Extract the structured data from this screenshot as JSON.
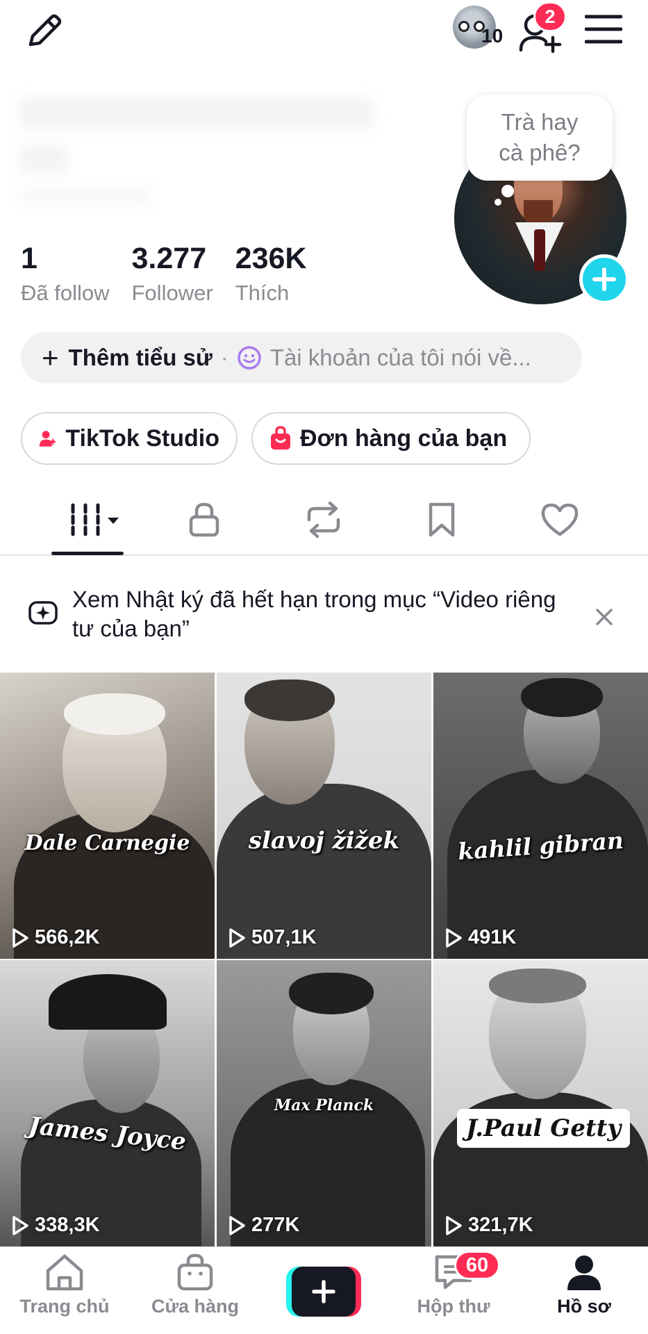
{
  "top_bar": {
    "story_count": "10",
    "friend_requests_badge": "2"
  },
  "profile": {
    "bubble_line1": "Trà hay",
    "bubble_line2": "cà phê?"
  },
  "stats": [
    {
      "value": "1",
      "label": "Đã follow"
    },
    {
      "value": "3.277",
      "label": "Follower"
    },
    {
      "value": "236K",
      "label": "Thích"
    }
  ],
  "bio": {
    "add_label": "Thêm tiểu sử",
    "separator": "·",
    "placeholder": "Tài khoản của tôi nói về..."
  },
  "actions": {
    "studio_label": "TikTok Studio",
    "orders_label": "Đơn hàng của bạn"
  },
  "tabs": [
    {
      "icon": "grid-icon"
    },
    {
      "icon": "lock-icon"
    },
    {
      "icon": "repost-icon"
    },
    {
      "icon": "bookmark-icon"
    },
    {
      "icon": "heart-icon"
    }
  ],
  "notice": {
    "text": "Xem Nhật ký đã hết hạn trong mục “Video riêng tư của bạn”"
  },
  "videos": [
    {
      "caption": "Dale Carnegie",
      "views": "566,2K"
    },
    {
      "caption": "slavoj žižek",
      "views": "507,1K"
    },
    {
      "caption": "kahlil gibran",
      "views": "491K"
    },
    {
      "caption": "James Joyce",
      "views": "338,3K"
    },
    {
      "caption": "Max Planck",
      "views": "277K"
    },
    {
      "caption": "J.Paul Getty",
      "views": "321,7K"
    }
  ],
  "bottom_nav": {
    "home_label": "Trang chủ",
    "shop_label": "Cửa hàng",
    "inbox_label": "Hộp thư",
    "inbox_badge": "60",
    "profile_label": "Hồ sơ"
  },
  "colors": {
    "accent_pink": "#fe2c55",
    "accent_cyan": "#20d5ec",
    "text_primary": "#161823",
    "text_secondary": "#8a8b91"
  }
}
